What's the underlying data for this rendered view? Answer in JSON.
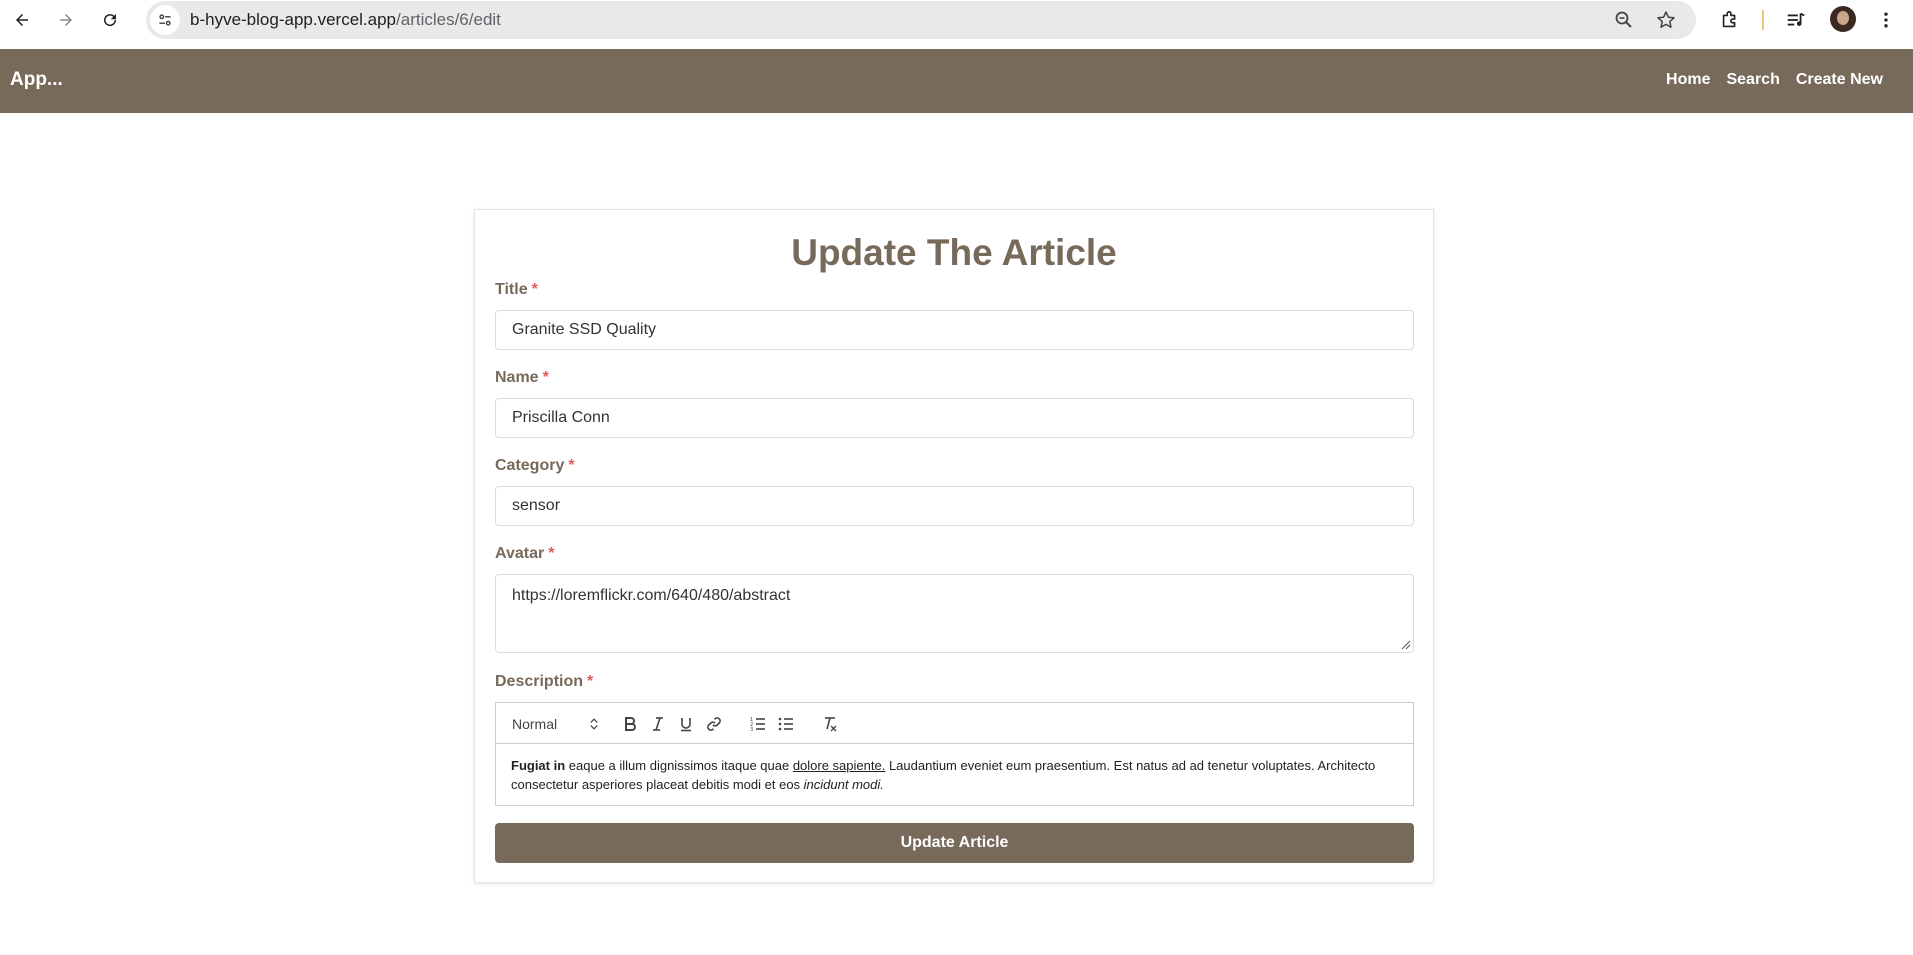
{
  "browser": {
    "url_host": "b-hyve-blog-app.vercel.app",
    "url_path": "/articles/6/edit"
  },
  "header": {
    "brand": "App...",
    "nav": [
      "Home",
      "Search",
      "Create New"
    ]
  },
  "form": {
    "title": "Update The Article",
    "required_marker": "*",
    "fields": {
      "title": {
        "label": "Title",
        "value": "Granite SSD Quality"
      },
      "name": {
        "label": "Name",
        "value": "Priscilla Conn"
      },
      "category": {
        "label": "Category",
        "value": "sensor"
      },
      "avatar": {
        "label": "Avatar",
        "value": "https://loremflickr.com/640/480/abstract"
      },
      "description": {
        "label": "Description"
      }
    },
    "editor": {
      "header_select": "Normal",
      "content": {
        "bold": "Fugiat in",
        "text1": " eaque a illum dignissimos itaque quae ",
        "underline": "dolore sapiente.",
        "text2": " Laudantium eveniet eum praesentium. Est natus ad ad tenetur voluptates. Architecto consectetur asperiores placeat debitis modi et eos ",
        "italic": "incidunt modi."
      }
    },
    "submit_label": "Update Article"
  },
  "colors": {
    "brand": "#786a5b",
    "required": "#e05a5a"
  }
}
